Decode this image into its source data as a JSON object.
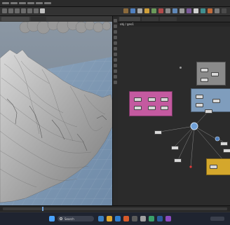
{
  "app": {
    "menu_items": [
      "File",
      "Edit",
      "Render",
      "Assets",
      "Windows",
      "Help"
    ],
    "network_path": "obj / geo1"
  },
  "network": {
    "boxes": [
      {
        "label": "",
        "color": "#c45aa0"
      },
      {
        "label": "",
        "color": "#7f9dbd"
      },
      {
        "label": "",
        "color": "#8a8a8a"
      },
      {
        "label": "",
        "color": "#d4a72c"
      }
    ]
  },
  "taskbar": {
    "search_placeholder": "Search"
  },
  "colors": {
    "viewport_bg": "#7c8a99",
    "terrain": "#b9b9b9",
    "network_bg": "#2b2b2b",
    "taskbar_bg": "#1f2430",
    "accent_blue": "#6fa0d8",
    "wire_red": "#e03a3a"
  }
}
